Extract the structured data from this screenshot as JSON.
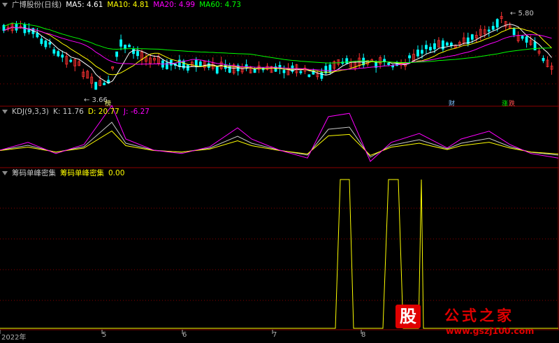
{
  "panels": {
    "main": {
      "title": "广博股份(日线)",
      "ma": [
        {
          "label": "MA5: 4.61",
          "color": "#ffffff"
        },
        {
          "label": "MA10: 4.81",
          "color": "#ffff00"
        },
        {
          "label": "MA20: 4.99",
          "color": "#ff00ff"
        },
        {
          "label": "MA60: 4.73",
          "color": "#00ff00"
        }
      ]
    },
    "kdj": {
      "title": "KDJ(9,3,3)",
      "values": [
        {
          "label": "K: 11.76",
          "color": "#c8c8c8"
        },
        {
          "label": "D: 20.77",
          "color": "#ffff00"
        },
        {
          "label": "J: -6.27",
          "color": "#ff00ff"
        }
      ]
    },
    "chip": {
      "title": "筹码单峰密集",
      "series_label": "筹码单峰密集",
      "value": "0.00",
      "series_color": "#ffff00"
    }
  },
  "annotations": {
    "high": "5.80",
    "low": "3.66",
    "badge_low": "榜",
    "badge_mid": "财",
    "badge_right": "涨",
    "badge_right2": "跌"
  },
  "x_axis": {
    "labels": [
      "2022年",
      "5",
      "6",
      "7",
      "8"
    ]
  },
  "watermark": {
    "glyph": "股",
    "name": "公式之家",
    "url": "www.gszj100.com"
  },
  "colors": {
    "up": "#ff3232",
    "down": "#00ffff",
    "grid": "#8b0000",
    "ma5": "#ffffff",
    "ma10": "#ffff00",
    "ma20": "#ff00ff",
    "ma60": "#00ff00"
  },
  "chart_data": [
    {
      "type": "candlestick",
      "title": "广博股份(日线)",
      "x": [
        "2022年",
        "5",
        "6",
        "7",
        "8"
      ],
      "series": [
        {
          "name": "MA5",
          "values": [
            4.61
          ]
        },
        {
          "name": "MA10",
          "values": [
            4.81
          ]
        },
        {
          "name": "MA20",
          "values": [
            4.99
          ]
        },
        {
          "name": "MA60",
          "values": [
            4.73
          ]
        }
      ],
      "annotations": [
        "5.80",
        "3.66"
      ]
    },
    {
      "type": "line",
      "title": "KDJ(9,3,3)",
      "series": [
        {
          "name": "K",
          "values": [
            11.76
          ]
        },
        {
          "name": "D",
          "values": [
            20.77
          ]
        },
        {
          "name": "J",
          "values": [
            -6.27
          ]
        }
      ]
    },
    {
      "type": "line",
      "title": "筹码单峰密集",
      "series": [
        {
          "name": "筹码单峰密集",
          "values": [
            0.0
          ]
        }
      ]
    }
  ]
}
